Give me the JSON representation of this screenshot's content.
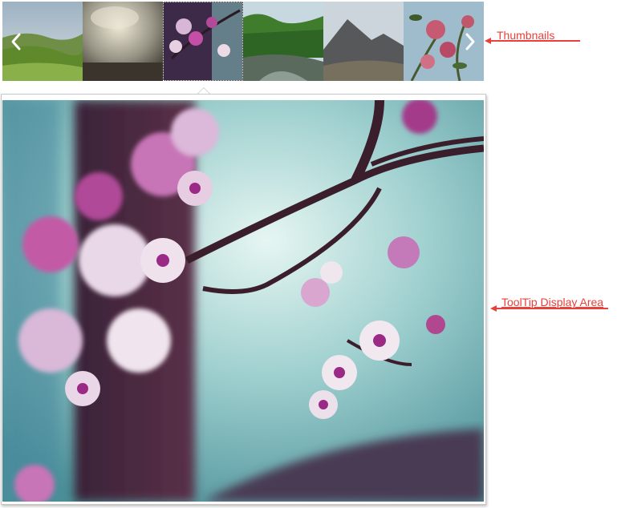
{
  "thumbnails": [
    {
      "name": "green-hills",
      "colors": [
        "#7f9ab0",
        "#6f8f4e",
        "#4e7a2e"
      ]
    },
    {
      "name": "cloudy-sky",
      "colors": [
        "#cfc9b6",
        "#8a8678",
        "#4a4338"
      ]
    },
    {
      "name": "cherry-blossom",
      "colors": [
        "#7a2a6a",
        "#c9a6c8",
        "#3a2a40"
      ],
      "active": true
    },
    {
      "name": "forest-river",
      "colors": [
        "#bfd0d8",
        "#3f7a30",
        "#4a5a4a"
      ]
    },
    {
      "name": "mountain",
      "colors": [
        "#c9d2da",
        "#5a5a5a",
        "#6e6a5e"
      ]
    },
    {
      "name": "red-flowers",
      "colors": [
        "#a8c8d8",
        "#b8566a",
        "#4a6a3a"
      ]
    }
  ],
  "nav": {
    "prev_icon": "chevron-left-icon",
    "next_icon": "chevron-right-icon"
  },
  "annotations": {
    "thumbnails_label": "Thumbnails",
    "tooltip_label": "ToolTip Display Area"
  },
  "colors": {
    "annotation": "#e8413c",
    "border": "#c8c8c8"
  }
}
